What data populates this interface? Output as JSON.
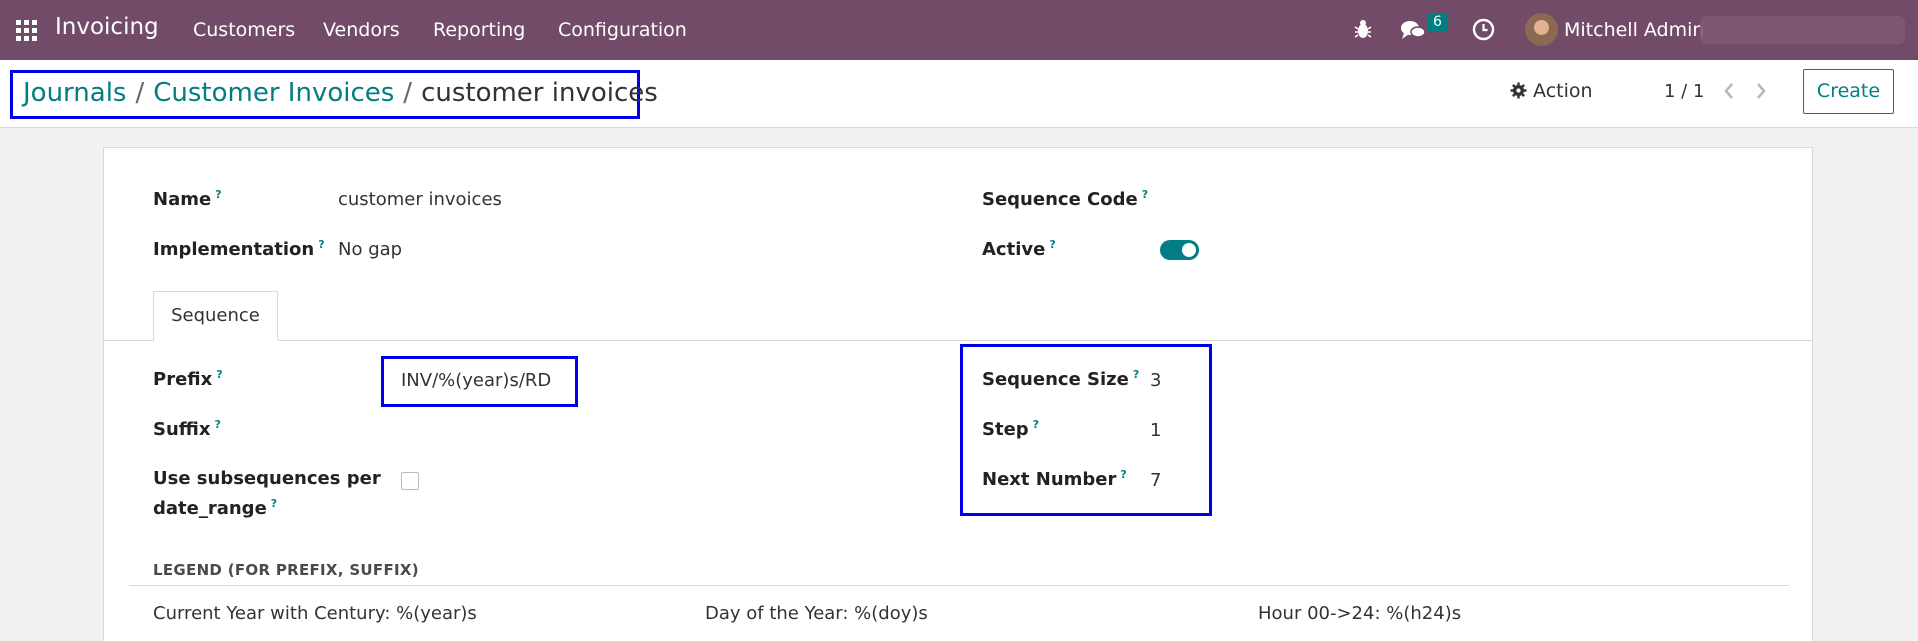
{
  "navbar": {
    "app_title": "Invoicing",
    "menu": [
      "Customers",
      "Vendors",
      "Reporting",
      "Configuration"
    ],
    "messages_count": "6",
    "user_name": "Mitchell Admin",
    "icons": [
      "apps-grid-icon",
      "bug-icon",
      "chat-icon",
      "clock-icon"
    ]
  },
  "control": {
    "breadcrumb": [
      "Journals",
      "Customer Invoices",
      "customer invoices"
    ],
    "action_label": "Action",
    "pager": "1 / 1",
    "create_label": "Create"
  },
  "form": {
    "name_label": "Name",
    "name_value": "customer invoices",
    "implementation_label": "Implementation",
    "implementation_value": "No gap",
    "sequence_code_label": "Sequence Code",
    "active_label": "Active",
    "active_value": true,
    "tab_label": "Sequence",
    "prefix_label": "Prefix",
    "prefix_value": "INV/%(year)s/RD",
    "suffix_label": "Suffix",
    "subseq_label_line1": "Use subsequences per",
    "subseq_label_line2": "date_range",
    "subseq_checked": false,
    "seq_size_label": "Sequence Size",
    "seq_size_value": "3",
    "step_label": "Step",
    "step_value": "1",
    "next_number_label": "Next Number",
    "next_number_value": "7",
    "help_mark": "?"
  },
  "legend": {
    "title": "LEGEND (FOR PREFIX, SUFFIX)",
    "items": [
      "Current Year with Century: %(year)s",
      "Day of the Year: %(doy)s",
      "Hour 00->24: %(h24)s"
    ]
  },
  "colors": {
    "navbar_bg": "#714b67",
    "accent": "#017e84",
    "annotation_box": "#0000e6"
  }
}
